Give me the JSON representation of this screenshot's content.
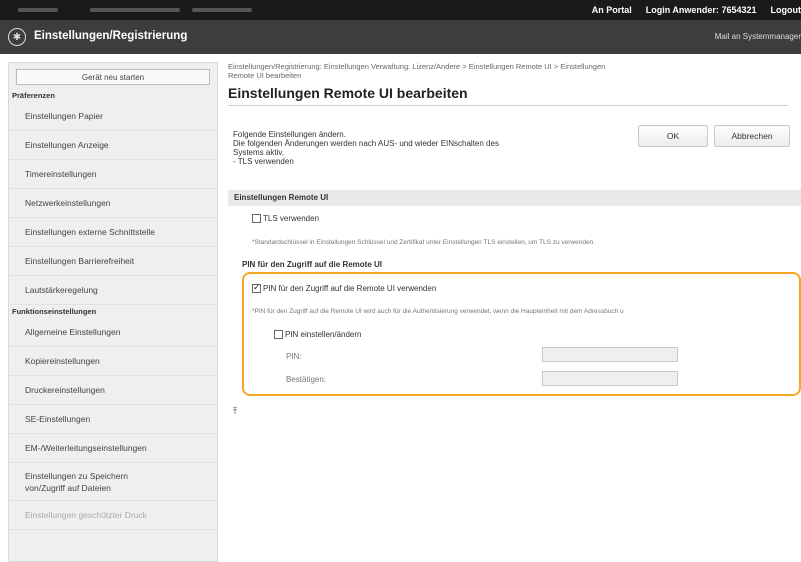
{
  "topbar": {
    "portal": "An Portal",
    "login_label": "Login Anwender:",
    "login_id": "7654321",
    "logout": "Logout"
  },
  "appbar": {
    "title": "Einstellungen/Registrierung",
    "mail": "Mail an Systemmanager"
  },
  "sidebar": {
    "restart": "Gerät neu starten",
    "section1": "Präferenzen",
    "items1": [
      "Einstellungen Papier",
      "Einstellungen Anzeige",
      "Timereinstellungen",
      "Netzwerkeinstellungen",
      "Einstellungen externe Schnittstelle",
      "Einstellungen Barrierefreiheit",
      "Lautstärkeregelung"
    ],
    "section2": "Funktionseinstellungen",
    "items2": [
      "Allgemeine Einstellungen",
      "Kopiereinstellungen",
      "Druckereinstellungen",
      "SE-Einstellungen",
      "EM-/Weiterleitungseinstellungen"
    ],
    "item_storage_line1": "Einstellungen zu Speichern",
    "item_storage_line2": "von/Zugriff auf Dateien",
    "item_secure_print": "Einstellungen geschützter Druck"
  },
  "main": {
    "breadcrumb_line1": "Einstellungen/Registrierung: Einstellungen Verwaltung: Lizenz/Andere > Einstellungen Remote UI > Einstellungen",
    "breadcrumb_line2": "Remote UI bearbeiten",
    "title": "Einstellungen Remote UI bearbeiten",
    "intro_line1": "Folgende Einstellungen ändern.",
    "intro_line2": "Die folgenden Änderungen werden nach AUS- und wieder EINschalten des",
    "intro_line3": "Systems aktiv.",
    "intro_line4": "- TLS verwenden",
    "ok": "OK",
    "cancel": "Abbrechen",
    "section_header": "Einstellungen Remote UI",
    "tls_label": "TLS verwenden",
    "tls_checked": false,
    "tls_note": "*Standardschlüssel in Einstellungen Schlüssel und Zertifikat unter Einstellungen TLS einstellen, um TLS zu verwenden.",
    "pin_header": "PIN für den Zugriff auf die Remote UI",
    "pin_use_label": "PIN für den Zugriff auf die Remote UI verwenden",
    "pin_use_checked": true,
    "pin_note": "*PIN für den Zugriff auf die Remote UI wird auch für die Authentisierung verwendet, wenn die Haupteinheit mit dem Adressbuch u",
    "pin_set_label": "PIN einstellen/ändern",
    "pin_set_checked": false,
    "pin_field_label": "PIN:",
    "confirm_field_label": "Bestätigen:",
    "pin_value": "",
    "confirm_value": ""
  },
  "colors": {
    "highlight": "#f5a623",
    "topbar": "#1a1a1a",
    "appbar": "#3d3d3d"
  }
}
